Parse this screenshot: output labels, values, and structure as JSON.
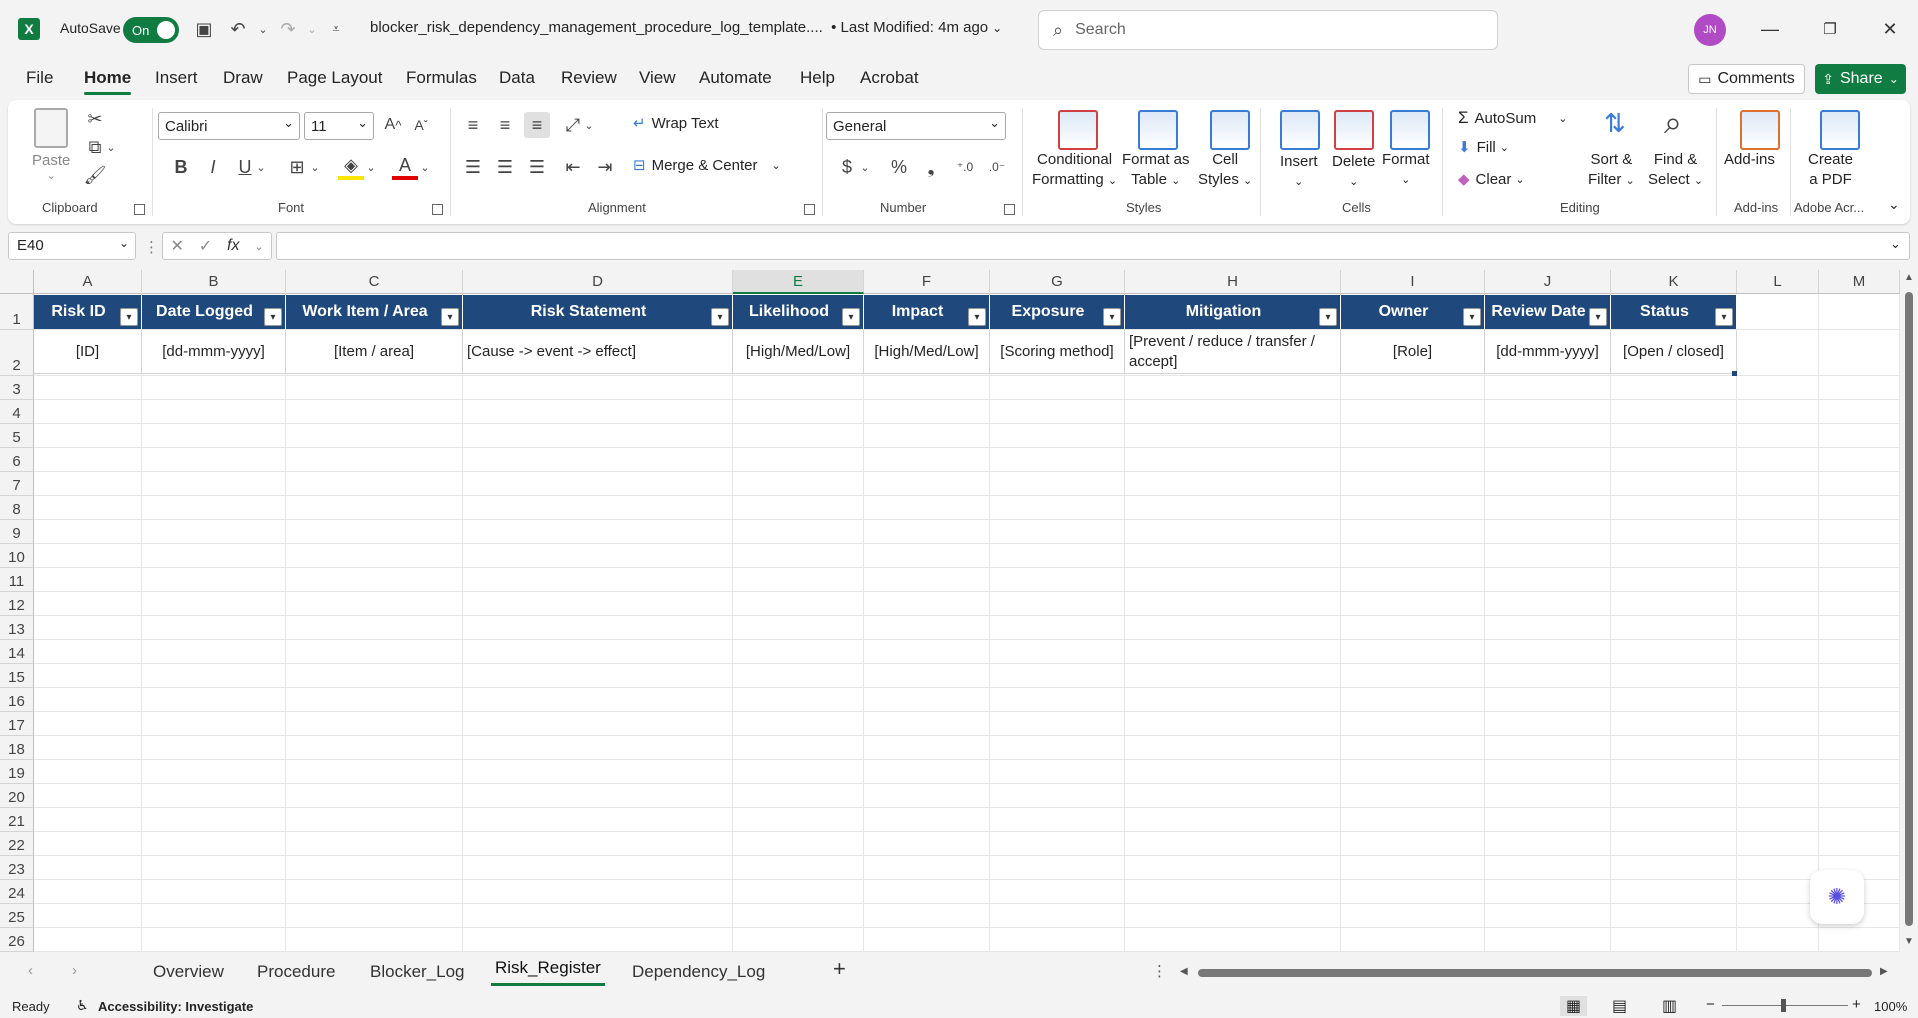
{
  "titlebar": {
    "app_icon": "excel-logo",
    "autosave_label": "AutoSave",
    "autosave_state": "On",
    "doc_title": "blocker_risk_dependency_management_procedure_log_template....",
    "modified": "• Last Modified: 4m ago",
    "search_placeholder": "Search",
    "avatar_initials": "JN"
  },
  "menu": {
    "items": [
      "File",
      "Home",
      "Insert",
      "Draw",
      "Page Layout",
      "Formulas",
      "Data",
      "Review",
      "View",
      "Automate",
      "Help",
      "Acrobat"
    ],
    "active": "Home",
    "comments": "Comments",
    "share": "Share"
  },
  "ribbon": {
    "clipboard": {
      "label": "Clipboard",
      "paste": "Paste"
    },
    "font": {
      "label": "Font",
      "name": "Calibri",
      "size": "11",
      "bold": "B",
      "italic": "I",
      "underline": "U"
    },
    "alignment": {
      "label": "Alignment",
      "wrap": "Wrap Text",
      "merge": "Merge & Center"
    },
    "number": {
      "label": "Number",
      "format": "General"
    },
    "styles": {
      "label": "Styles",
      "conditional": [
        "Conditional",
        "Formatting"
      ],
      "format_table": [
        "Format as",
        "Table"
      ],
      "cell_styles": [
        "Cell",
        "Styles"
      ]
    },
    "cells": {
      "label": "Cells",
      "insert": "Insert",
      "delete": "Delete",
      "format": "Format"
    },
    "editing": {
      "label": "Editing",
      "autosum": "AutoSum",
      "fill": "Fill",
      "clear": "Clear",
      "sort": [
        "Sort &",
        "Filter"
      ],
      "find": [
        "Find &",
        "Select"
      ]
    },
    "addins": {
      "label": "Add-ins",
      "btn": "Add-ins"
    },
    "adobe": {
      "label": "Adobe Acr...",
      "btn": [
        "Create",
        "a PDF"
      ]
    }
  },
  "formula_bar": {
    "name_box": "E40",
    "fx": "fx",
    "value": ""
  },
  "sheet": {
    "columns": [
      "A",
      "B",
      "C",
      "D",
      "E",
      "F",
      "G",
      "H",
      "I",
      "J",
      "K",
      "L",
      "M"
    ],
    "selected_column": "E",
    "rows": [
      "1",
      "2",
      "3",
      "4",
      "5",
      "6",
      "7",
      "8",
      "9",
      "10",
      "11",
      "12",
      "13",
      "14",
      "15",
      "16",
      "17",
      "18",
      "19",
      "20",
      "21",
      "22",
      "23",
      "24",
      "25",
      "26"
    ],
    "headers": [
      "Risk ID",
      "Date Logged",
      "Work Item / Area",
      "Risk Statement",
      "Likelihood",
      "Impact",
      "Exposure",
      "Mitigation",
      "Owner",
      "Review Date",
      "Status"
    ],
    "row2": [
      "[ID]",
      "[dd-mmm-yyyy]",
      "[Item / area]",
      "[Cause -> event -> effect]",
      "[High/Med/Low]",
      "[High/Med/Low]",
      "[Scoring method]",
      "[Prevent / reduce / transfer / accept]",
      "[Role]",
      "[dd-mmm-yyyy]",
      "[Open / closed]"
    ],
    "header_color": "#1f497d"
  },
  "tabs": {
    "items": [
      "Overview",
      "Procedure",
      "Blocker_Log",
      "Risk_Register",
      "Dependency_Log"
    ],
    "active": "Risk_Register",
    "add": "+"
  },
  "status": {
    "ready": "Ready",
    "accessibility": "Accessibility: Investigate",
    "zoom": "100%"
  },
  "colors": {
    "excel_green": "#107c41",
    "header_blue": "#1f497d"
  }
}
